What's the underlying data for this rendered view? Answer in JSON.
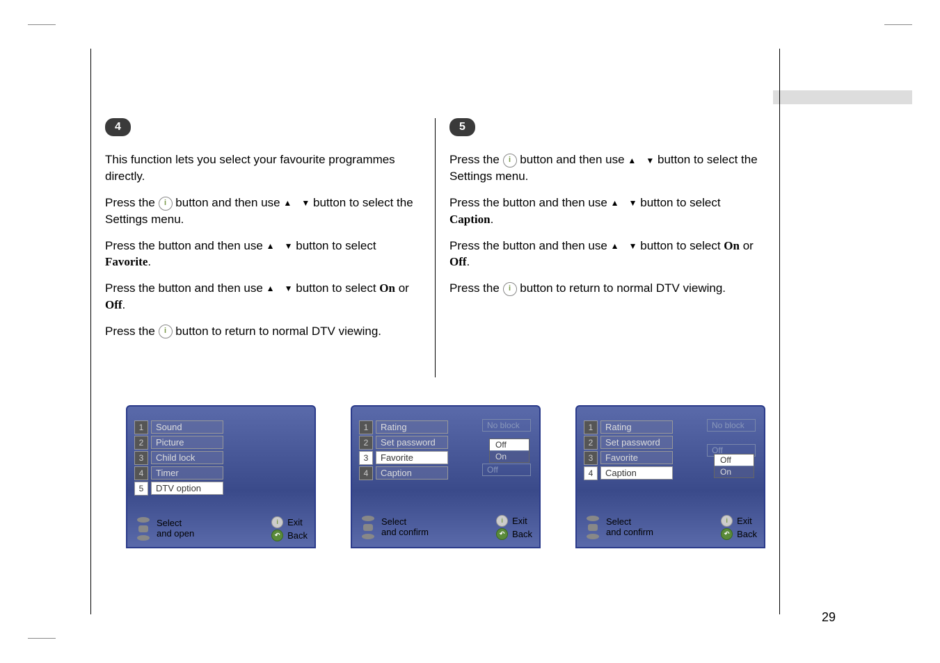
{
  "page_number": "29",
  "step4": {
    "badge": "4",
    "intro": "This function lets you select your favourite programmes directly.",
    "p1_a": "Press the ",
    "p1_b": " button and then use ",
    "p1_c": " button to select the Settings menu.",
    "p2_a": "Press the        button and then use ",
    "p2_b": " button to select ",
    "p2_target": "Favorite",
    "p3_a": "Press the        button and then use ",
    "p3_b": " button to select ",
    "p3_target": "On",
    "p3_or": " or ",
    "p3_target2": "Off",
    "p4_a": "Press the ",
    "p4_b": " button to return to normal DTV viewing."
  },
  "step5": {
    "badge": "5",
    "p1_a": "Press the ",
    "p1_b": " button and then use ",
    "p1_c": " button to select the Settings menu.",
    "p2_a": "Press the        button and then use ",
    "p2_b": " button to select ",
    "p2_target": "Caption",
    "p3_a": "Press the        button and then use ",
    "p3_b": " button to select ",
    "p3_target": "On",
    "p3_or": " or ",
    "p3_target2": "Off",
    "p4_a": "Press the ",
    "p4_b": " button to return to normal DTV viewing."
  },
  "osd1": {
    "items": [
      {
        "num": "1",
        "label": "Sound"
      },
      {
        "num": "2",
        "label": "Picture"
      },
      {
        "num": "3",
        "label": "Child lock"
      },
      {
        "num": "4",
        "label": "Timer"
      },
      {
        "num": "5",
        "label": "DTV option",
        "active": true
      }
    ],
    "footer_left1": "Select",
    "footer_left2": "and open",
    "footer_exit": "Exit",
    "footer_back": "Back"
  },
  "osd2": {
    "items": [
      {
        "num": "1",
        "label": "Rating"
      },
      {
        "num": "2",
        "label": "Set password"
      },
      {
        "num": "3",
        "label": "Favorite",
        "active": true
      },
      {
        "num": "4",
        "label": "Caption"
      }
    ],
    "val_rating": "No block",
    "val_caption": "Off",
    "dropdown": [
      "Off",
      "On"
    ],
    "dropdown_sel": "Off",
    "footer_left1": "Select",
    "footer_left2": "and confirm",
    "footer_exit": "Exit",
    "footer_back": "Back"
  },
  "osd3": {
    "items": [
      {
        "num": "1",
        "label": "Rating"
      },
      {
        "num": "2",
        "label": "Set password"
      },
      {
        "num": "3",
        "label": "Favorite"
      },
      {
        "num": "4",
        "label": "Caption",
        "active": true
      }
    ],
    "val_rating": "No block",
    "val_favorite": "Off",
    "dropdown": [
      "Off",
      "On"
    ],
    "dropdown_sel": "Off",
    "footer_left1": "Select",
    "footer_left2": "and confirm",
    "footer_exit": "Exit",
    "footer_back": "Back"
  }
}
